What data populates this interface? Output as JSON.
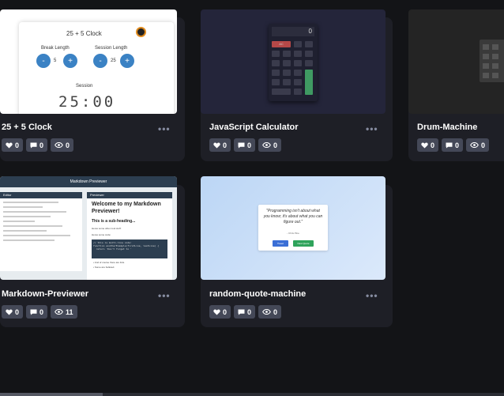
{
  "projects": [
    {
      "title": "25 + 5 Clock",
      "likes": "0",
      "comments": "0",
      "views": "0",
      "preview": {
        "heading": "25 + 5 Clock",
        "break_label": "Break Length",
        "session_length_label": "Session Length",
        "break_value": "5",
        "session_value": "25",
        "session_label": "Session",
        "timer": "25:00",
        "minus": "-",
        "plus": "+"
      }
    },
    {
      "title": "JavaScript Calculator",
      "likes": "0",
      "comments": "0",
      "views": "0",
      "preview": {
        "display": "0",
        "ac": "AC"
      }
    },
    {
      "title": "Drum-Machine",
      "likes": "0",
      "comments": "0",
      "views": "0"
    },
    {
      "title": "Markdown-Previewer",
      "likes": "0",
      "comments": "0",
      "views": "11",
      "preview": {
        "header": "Markdown Previewer",
        "editor": "Editor",
        "previewer": "Previewer",
        "h1": "Welcome to my Markdown Previewer!",
        "h2": "This is a sub-heading...",
        "h3a": "Heres some other cool stuff:",
        "h3b": "Heres some code:",
        "code": "// this is multi-line code:\nfunction anotherExample(firstLine, lastLine) {\n  return 'Don't forget to '",
        "li1": "• And of course there are lists.",
        "li2": "• Some are bulleted."
      }
    },
    {
      "title": "random-quote-machine",
      "likes": "0",
      "comments": "0",
      "views": "0",
      "preview": {
        "quote": "\"Programming isn't about what you know; it's about what you can figure out.\"",
        "author": "- Chris Pine",
        "tweet": "Tweet",
        "new_quote": "New Quote"
      }
    }
  ],
  "more_label": "•••"
}
